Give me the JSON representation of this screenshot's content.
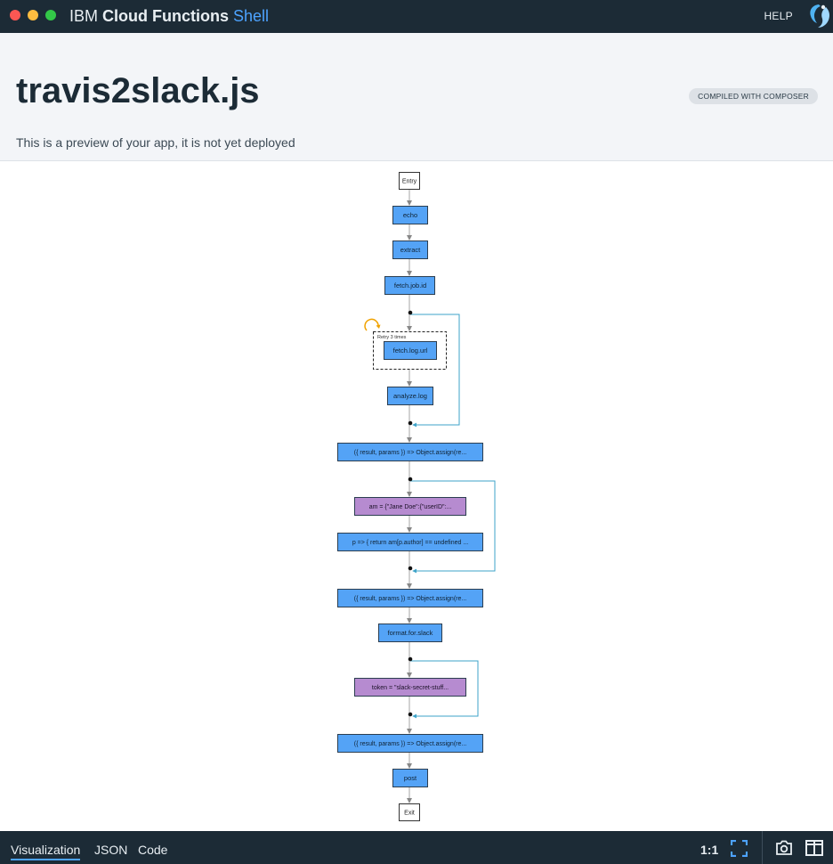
{
  "window": {
    "title_prefix": "IBM ",
    "title_bold": "Cloud Functions ",
    "title_accent": "Shell",
    "help_label": "HELP"
  },
  "header": {
    "title": "travis2slack.js",
    "badge": "COMPILED WITH COMPOSER",
    "subtitle": "This is a preview of your app, it is not yet deployed"
  },
  "graph": {
    "entry": "Entry",
    "exit": "Exit",
    "retry_label": "Retry 3 times",
    "nodes": {
      "echo": "echo",
      "extract": "extract",
      "fetch_job_id": "fetch.job.id",
      "fetch_log_url": "fetch.log.url",
      "analyze_log": "analyze.log",
      "assign1": "({ result, params }) => Object.assign(re...",
      "am": "am = {\"Jane Doe\":{\"userID\":...",
      "lookup": "p => { return am[p.author] == undefined ...",
      "assign2": "({ result, params }) => Object.assign(re...",
      "format_for_slack": "format.for.slack",
      "token": "token = \"slack-secret-stuff...",
      "assign3": "({ result, params }) => Object.assign(re...",
      "post": "post"
    }
  },
  "footer": {
    "tabs": [
      "Visualization",
      "JSON",
      "Code"
    ],
    "zoom": "1:1"
  },
  "colors": {
    "action": "#54a3f6",
    "function": "#b68bd0",
    "edge_line": "#b5b5b5",
    "loop_line": "#3ea3c9",
    "chrome": "#1c2b36"
  }
}
